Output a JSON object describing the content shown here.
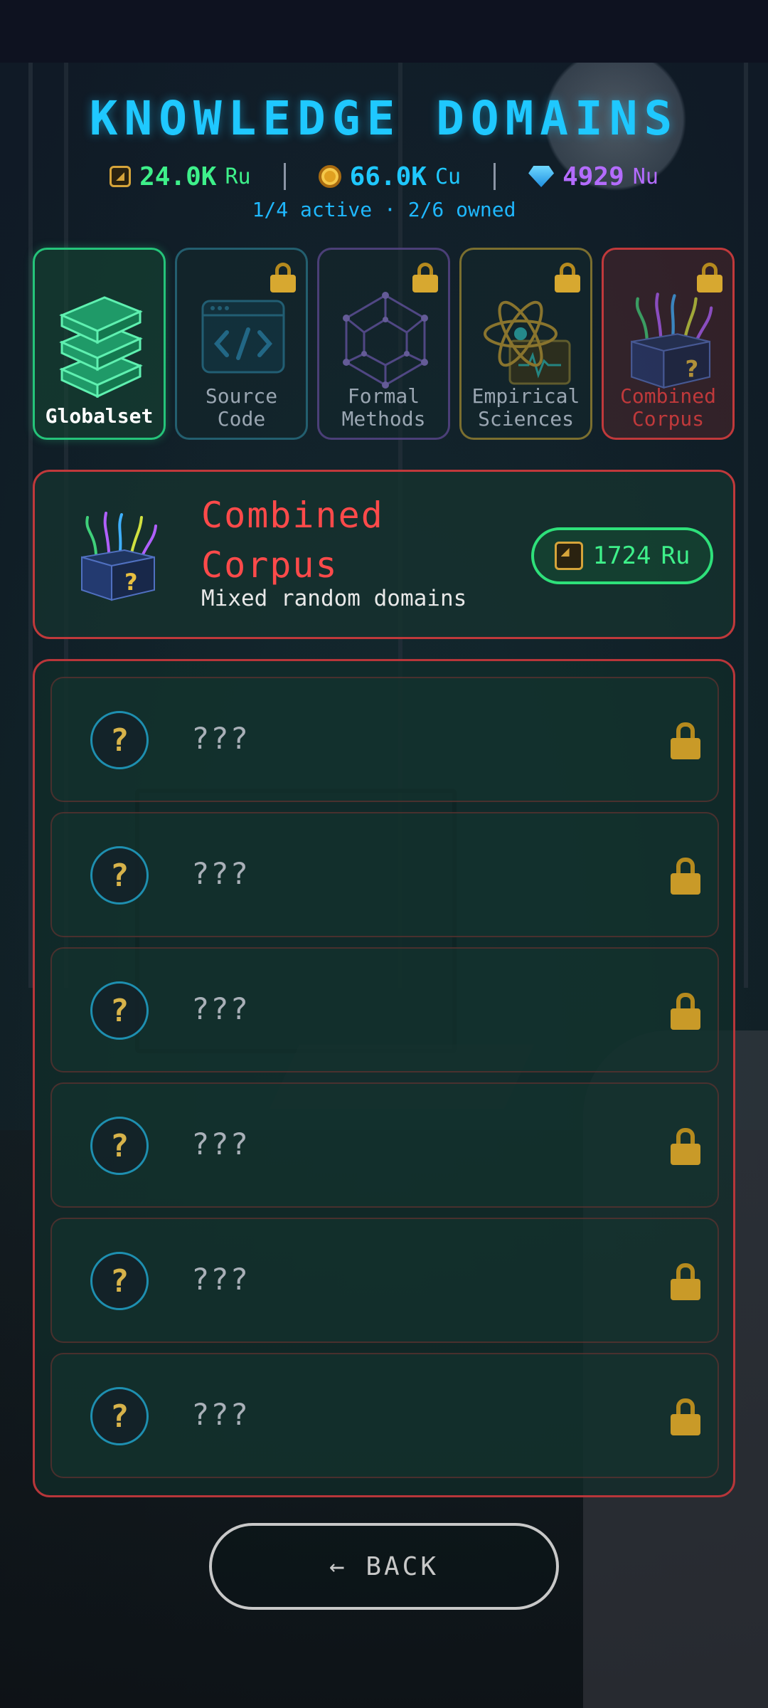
{
  "header": {
    "title": "KNOWLEDGE DOMAINS",
    "currencies": [
      {
        "icon": "chip-icon",
        "amount": "24.0K",
        "unit": "Ru",
        "color": "#3ef08a"
      },
      {
        "icon": "coin-icon",
        "amount": "66.0K",
        "unit": "Cu",
        "color": "#1fc8ff"
      },
      {
        "icon": "gem-icon",
        "amount": "4929",
        "unit": "Nu",
        "color": "#b46cff"
      }
    ],
    "status": "1/4 active · 2/6 owned"
  },
  "domains": [
    {
      "label": "Globalset",
      "locked": false,
      "selected": false,
      "icon": "books-icon"
    },
    {
      "label_line1": "Source",
      "label_line2": "Code",
      "locked": true,
      "icon": "code-window-icon"
    },
    {
      "label_line1": "Formal",
      "label_line2": "Methods",
      "locked": true,
      "icon": "graph-polyhedron-icon"
    },
    {
      "label_line1": "Empirical",
      "label_line2": "Sciences",
      "locked": true,
      "icon": "atom-icon"
    },
    {
      "label_line1": "Combined",
      "label_line2": "Corpus",
      "locked": true,
      "selected": true,
      "icon": "mystery-box-icon"
    }
  ],
  "selected": {
    "title_line1": "Combined",
    "title_line2": "Corpus",
    "subtitle": "Mixed random domains",
    "price_amount": "1724",
    "price_unit": "Ru"
  },
  "items": [
    {
      "name": "???",
      "locked": true
    },
    {
      "name": "???",
      "locked": true
    },
    {
      "name": "???",
      "locked": true
    },
    {
      "name": "???",
      "locked": true
    },
    {
      "name": "???",
      "locked": true
    },
    {
      "name": "???",
      "locked": true
    }
  ],
  "back_label": "← BACK"
}
